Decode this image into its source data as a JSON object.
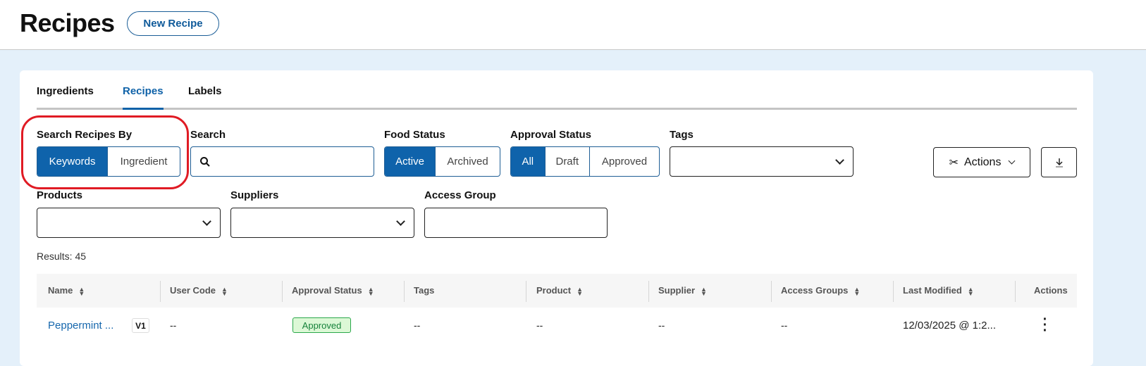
{
  "header": {
    "title": "Recipes",
    "new_recipe_label": "New Recipe"
  },
  "tabs": [
    {
      "label": "Ingredients",
      "active": false
    },
    {
      "label": "Recipes",
      "active": true
    },
    {
      "label": "Labels",
      "active": false
    }
  ],
  "filters": {
    "search_by": {
      "label": "Search Recipes By",
      "options": [
        "Keywords",
        "Ingredient"
      ],
      "selected": "Keywords"
    },
    "search": {
      "label": "Search",
      "value": "",
      "placeholder": ""
    },
    "food_status": {
      "label": "Food Status",
      "options": [
        "Active",
        "Archived"
      ],
      "selected": "Active"
    },
    "approval_status": {
      "label": "Approval Status",
      "options": [
        "All",
        "Draft",
        "Approved"
      ],
      "selected": "All"
    },
    "tags": {
      "label": "Tags",
      "value": ""
    },
    "products": {
      "label": "Products",
      "value": ""
    },
    "suppliers": {
      "label": "Suppliers",
      "value": ""
    },
    "access_group": {
      "label": "Access Group",
      "value": ""
    }
  },
  "toolbar": {
    "actions_label": "Actions",
    "download_icon": "download-icon"
  },
  "results": {
    "text": "Results: 45"
  },
  "table": {
    "columns": [
      "Name",
      "User Code",
      "Approval Status",
      "Tags",
      "Product",
      "Supplier",
      "Access Groups",
      "Last Modified",
      "Actions"
    ],
    "rows": [
      {
        "name": "Peppermint ...",
        "version": "V1",
        "user_code": "--",
        "approval_status": "Approved",
        "tags": "--",
        "product": "--",
        "supplier": "--",
        "access_groups": "--",
        "last_modified": "12/03/2025 @ 1:2..."
      }
    ]
  },
  "colors": {
    "primary": "#0f63ab",
    "highlight_ring": "#e01b24",
    "approved_bg": "#dcf8d6",
    "approved_text": "#16823a"
  }
}
